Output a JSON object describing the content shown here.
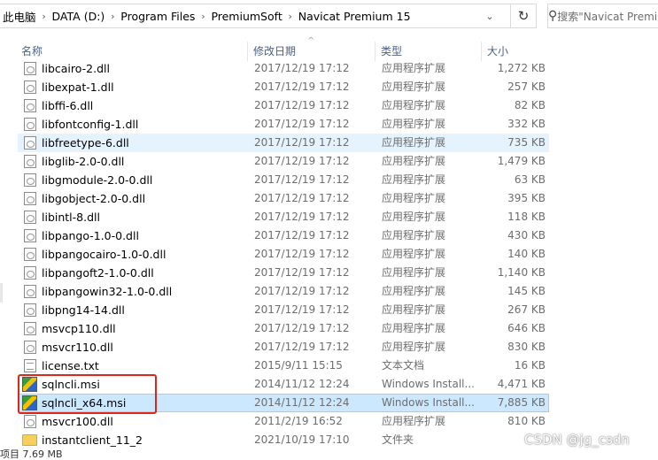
{
  "address": {
    "crumbs": [
      "此电脑",
      "DATA (D:)",
      "Program Files",
      "PremiumSoft",
      "Navicat Premium 15"
    ],
    "separator": "›",
    "dropdown": "⌄",
    "refresh": "↻"
  },
  "search": {
    "icon": "search-icon",
    "placeholder": "搜索\"Navicat Premiu"
  },
  "columns": {
    "name": "名称",
    "date": "修改日期",
    "type": "类型",
    "size": "大小",
    "sort_indicator": "^"
  },
  "files": [
    {
      "name": "libcairo-2.dll",
      "date": "2017/12/19 17:12",
      "type": "应用程序扩展",
      "size": "1,272 KB",
      "icon": "dll"
    },
    {
      "name": "libexpat-1.dll",
      "date": "2017/12/19 17:12",
      "type": "应用程序扩展",
      "size": "257 KB",
      "icon": "dll"
    },
    {
      "name": "libffi-6.dll",
      "date": "2017/12/19 17:12",
      "type": "应用程序扩展",
      "size": "82 KB",
      "icon": "dll"
    },
    {
      "name": "libfontconfig-1.dll",
      "date": "2017/12/19 17:12",
      "type": "应用程序扩展",
      "size": "332 KB",
      "icon": "dll"
    },
    {
      "name": "libfreetype-6.dll",
      "date": "2017/12/19 17:12",
      "type": "应用程序扩展",
      "size": "735 KB",
      "icon": "dll",
      "state": "hover"
    },
    {
      "name": "libglib-2.0-0.dll",
      "date": "2017/12/19 17:12",
      "type": "应用程序扩展",
      "size": "1,479 KB",
      "icon": "dll"
    },
    {
      "name": "libgmodule-2.0-0.dll",
      "date": "2017/12/19 17:12",
      "type": "应用程序扩展",
      "size": "63 KB",
      "icon": "dll"
    },
    {
      "name": "libgobject-2.0-0.dll",
      "date": "2017/12/19 17:12",
      "type": "应用程序扩展",
      "size": "395 KB",
      "icon": "dll"
    },
    {
      "name": "libintl-8.dll",
      "date": "2017/12/19 17:12",
      "type": "应用程序扩展",
      "size": "118 KB",
      "icon": "dll"
    },
    {
      "name": "libpango-1.0-0.dll",
      "date": "2017/12/19 17:12",
      "type": "应用程序扩展",
      "size": "430 KB",
      "icon": "dll"
    },
    {
      "name": "libpangocairo-1.0-0.dll",
      "date": "2017/12/19 17:12",
      "type": "应用程序扩展",
      "size": "140 KB",
      "icon": "dll"
    },
    {
      "name": "libpangoft2-1.0-0.dll",
      "date": "2017/12/19 17:12",
      "type": "应用程序扩展",
      "size": "1,140 KB",
      "icon": "dll"
    },
    {
      "name": "libpangowin32-1.0-0.dll",
      "date": "2017/12/19 17:12",
      "type": "应用程序扩展",
      "size": "145 KB",
      "icon": "dll"
    },
    {
      "name": "libpng14-14.dll",
      "date": "2017/12/19 17:12",
      "type": "应用程序扩展",
      "size": "267 KB",
      "icon": "dll"
    },
    {
      "name": "msvcp110.dll",
      "date": "2017/12/19 17:12",
      "type": "应用程序扩展",
      "size": "646 KB",
      "icon": "dll"
    },
    {
      "name": "msvcr110.dll",
      "date": "2017/12/19 17:12",
      "type": "应用程序扩展",
      "size": "830 KB",
      "icon": "dll"
    },
    {
      "name": "license.txt",
      "date": "2015/9/11 15:15",
      "type": "文本文档",
      "size": "16 KB",
      "icon": "txt"
    },
    {
      "name": "sqlncli.msi",
      "date": "2014/11/12 12:24",
      "type": "Windows Install...",
      "size": "4,471 KB",
      "icon": "msi"
    },
    {
      "name": "sqlncli_x64.msi",
      "date": "2014/11/12 12:24",
      "type": "Windows Install...",
      "size": "7,885 KB",
      "icon": "msi",
      "state": "selected"
    },
    {
      "name": "msvcr100.dll",
      "date": "2011/2/19 16:52",
      "type": "应用程序扩展",
      "size": "810 KB",
      "icon": "dll"
    },
    {
      "name": "instantclient_11_2",
      "date": "2021/10/19 17:10",
      "type": "文件夹",
      "size": "",
      "icon": "folder"
    }
  ],
  "status": {
    "text": "项目 7.69 MB"
  },
  "watermark": "CSDN @jg_csdn",
  "colors": {
    "selected_bg": "#cce8ff",
    "hover_bg": "#e5f3ff",
    "annotation": "#e0261b",
    "header_text": "#4d6082"
  }
}
